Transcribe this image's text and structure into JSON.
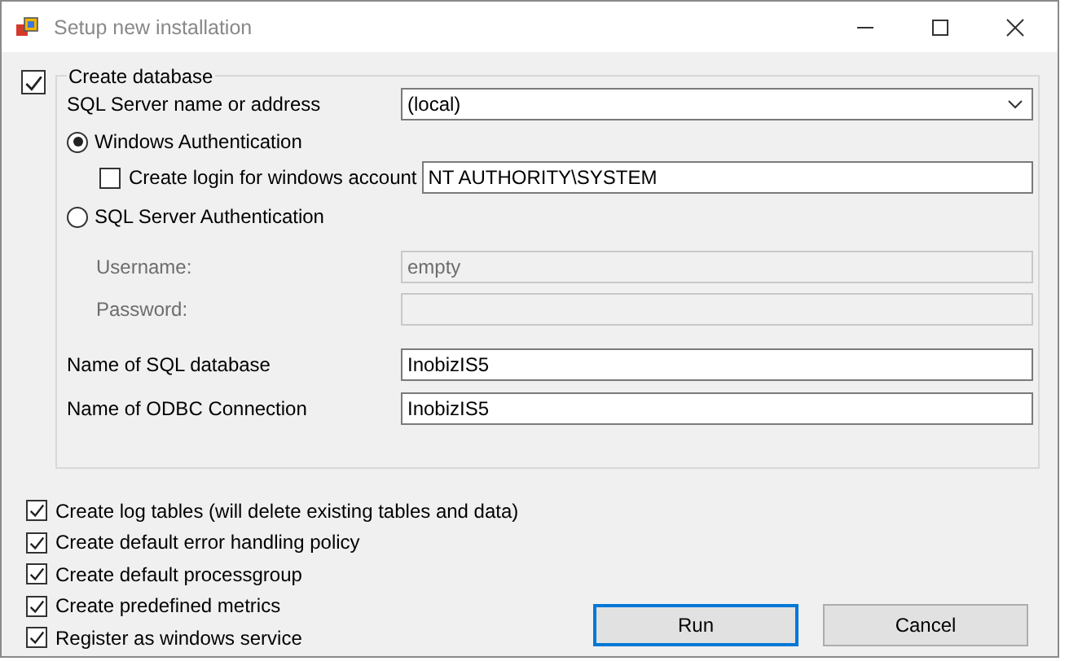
{
  "window": {
    "title": "Setup new installation"
  },
  "database": {
    "label": "Create database",
    "checked": true,
    "server": {
      "label": "SQL Server name or address",
      "value": "(local)"
    },
    "auth": [
      {
        "label": "Windows Authentication",
        "selected": true
      },
      {
        "label": "SQL Server Authentication",
        "selected": false
      }
    ],
    "create_login": {
      "label": "Create login for windows account",
      "checked": false,
      "value": "NT AUTHORITY\\SYSTEM"
    },
    "credentials": [
      {
        "label": "Username:",
        "value": "empty",
        "disabled": true
      },
      {
        "label": "Password:",
        "disabled": true
      }
    ],
    "names": [
      {
        "label": "Name of SQL database",
        "value": "InobizIS5"
      },
      {
        "label": "Name of ODBC Connection",
        "value": "InobizIS5"
      }
    ]
  },
  "options": [
    {
      "label": "Create log tables (will delete existing tables and data)",
      "checked": true
    },
    {
      "label": "Create default error handling policy",
      "checked": true
    },
    {
      "label": "Create default processgroup",
      "checked": true
    },
    {
      "label": "Create predefined metrics",
      "checked": true
    },
    {
      "label": "Register as windows service",
      "checked": true
    }
  ],
  "buttons": [
    {
      "label": "Run",
      "default": true
    },
    {
      "label": "Cancel",
      "default": false
    }
  ]
}
